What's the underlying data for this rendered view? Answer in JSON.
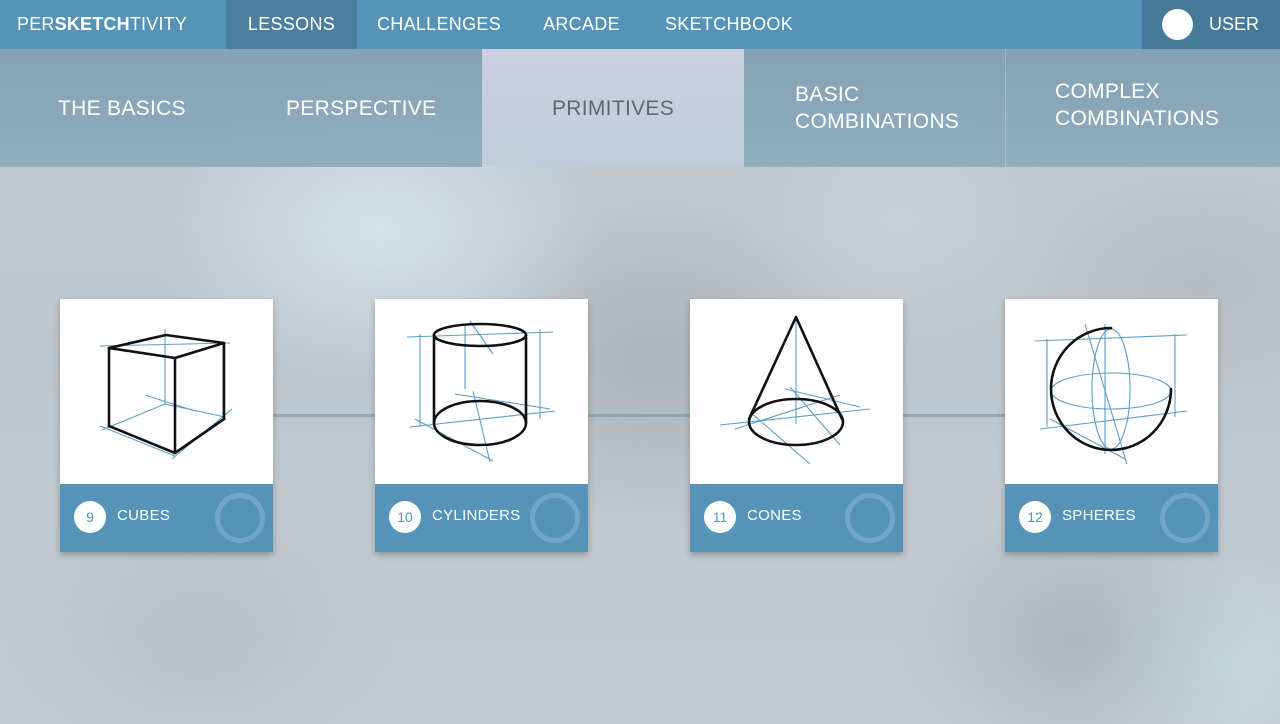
{
  "app": {
    "logo": {
      "prefix": "PER",
      "bold": "SKETCH",
      "suffix": "TIVITY"
    }
  },
  "nav": {
    "items": [
      {
        "label": "LESSONS",
        "active": true
      },
      {
        "label": "CHALLENGES",
        "active": false
      },
      {
        "label": "ARCADE",
        "active": false
      },
      {
        "label": "SKETCHBOOK",
        "active": false
      }
    ],
    "user_label": "USER"
  },
  "subtabs": [
    {
      "line1": "THE BASICS",
      "line2": "",
      "active": false
    },
    {
      "line1": "PERSPECTIVE",
      "line2": "",
      "active": false
    },
    {
      "line1": "PRIMITIVES",
      "line2": "",
      "active": true
    },
    {
      "line1": "BASIC",
      "line2": "COMBINATIONS",
      "active": false
    },
    {
      "line1": "COMPLEX",
      "line2": "COMBINATIONS",
      "active": false
    }
  ],
  "lessons": [
    {
      "number": "9",
      "title": "CUBES",
      "icon": "cube-sketch-icon"
    },
    {
      "number": "10",
      "title": "CYLINDERS",
      "icon": "cylinder-sketch-icon"
    },
    {
      "number": "11",
      "title": "CONES",
      "icon": "cone-sketch-icon"
    },
    {
      "number": "12",
      "title": "SPHERES",
      "icon": "sphere-sketch-icon"
    }
  ],
  "colors": {
    "accent": "#5593b8",
    "active_nav": "#4c7f9d",
    "construction_line": "#5aa0c6"
  }
}
